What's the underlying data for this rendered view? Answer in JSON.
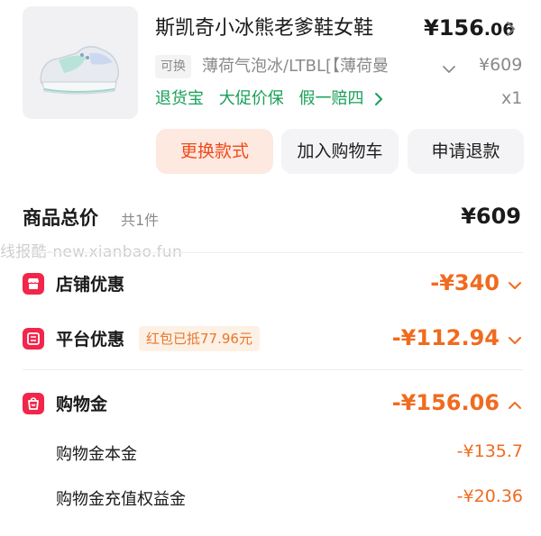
{
  "product": {
    "title": "斯凯奇小冰熊老爹鞋女鞋",
    "price_main": "¥156",
    "price_decimal": ".06",
    "tag": "可换",
    "spec": "薄荷气泡冰/LTBL[【薄荷曼",
    "original_price": "¥609",
    "quantity": "x1",
    "services": [
      "退货宝",
      "大促价保",
      "假一赔四"
    ]
  },
  "actions": {
    "change": "更换款式",
    "cart": "加入购物车",
    "refund": "申请退款"
  },
  "summary": {
    "total_label": "商品总价",
    "count": "共1件",
    "total_value": "¥609"
  },
  "watermark": "线报酷-new.xianbao.fun",
  "discounts": {
    "store": {
      "label": "店铺优惠",
      "value": "-¥340"
    },
    "platform": {
      "label": "平台优惠",
      "tag": "红包已抵77.96元",
      "value": "-¥112.94"
    },
    "shopping_money": {
      "label": "购物金",
      "value": "-¥156.06"
    },
    "shopping_money_base": {
      "label": "购物金本金",
      "value": "-¥135.7"
    },
    "shopping_money_bonus": {
      "label": "购物金充值权益金",
      "value": "-¥20.36"
    }
  },
  "colors": {
    "accent_orange": "#f06b1f",
    "brand_red": "#f2264a",
    "service_green": "#18a058",
    "primary_button_bg": "#fde9e0",
    "primary_button_text": "#f04a1a"
  },
  "icons": {
    "price_chevron": "chevron-right-icon",
    "spec_chevron": "chevron-down-icon",
    "store": "shop-icon",
    "platform": "coupon-icon",
    "shopping_money": "wallet-bag-icon",
    "shopping_money_toggle": "chevron-up-icon"
  }
}
